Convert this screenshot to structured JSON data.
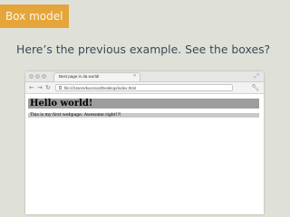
{
  "slide": {
    "section_tag": "Box model",
    "subtitle": "Here’s the previous example. See the boxes?"
  },
  "browser": {
    "tab_title": "Best page in da world!",
    "tab_close": "×",
    "url": "file:///Users/kuronos/Desktop/index.html",
    "nav": {
      "back": "←",
      "forward": "→",
      "reload": "↻"
    },
    "wrench_icon": "wrench-icon",
    "resize_icon": "resize-icon"
  },
  "page": {
    "heading": "Hello world!",
    "paragraph": "This is my first webpage. Awesome right!?!"
  },
  "colors": {
    "slide_background": "#dfe1d8",
    "tag_orange": "#e5a53a",
    "heading_box": "#9d9d9d",
    "paragraph_box": "#c9c9c9"
  }
}
